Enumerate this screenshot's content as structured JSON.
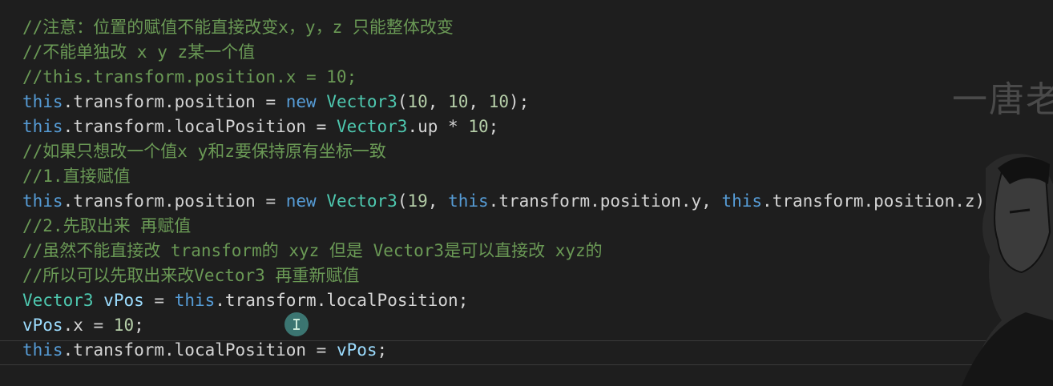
{
  "code": {
    "lines": [
      {
        "segments": [
          {
            "t": "//注意：位置的赋值不能直接改变x，y，z 只能整体改变",
            "c": "cmt"
          }
        ]
      },
      {
        "segments": [
          {
            "t": "//不能单独改 x y z某一个值",
            "c": "cmt"
          }
        ]
      },
      {
        "segments": [
          {
            "t": "//this.transform.position.x = 10;",
            "c": "cmt"
          }
        ]
      },
      {
        "segments": [
          {
            "t": "this",
            "c": "kw"
          },
          {
            "t": ".transform.position = ",
            "c": "plain"
          },
          {
            "t": "new",
            "c": "kw"
          },
          {
            "t": " ",
            "c": "plain"
          },
          {
            "t": "Vector3",
            "c": "typ"
          },
          {
            "t": "(",
            "c": "plain"
          },
          {
            "t": "10",
            "c": "num"
          },
          {
            "t": ", ",
            "c": "plain"
          },
          {
            "t": "10",
            "c": "num"
          },
          {
            "t": ", ",
            "c": "plain"
          },
          {
            "t": "10",
            "c": "num"
          },
          {
            "t": ");",
            "c": "plain"
          }
        ]
      },
      {
        "segments": [
          {
            "t": "this",
            "c": "kw"
          },
          {
            "t": ".transform.localPosition = ",
            "c": "plain"
          },
          {
            "t": "Vector3",
            "c": "typ"
          },
          {
            "t": ".up * ",
            "c": "plain"
          },
          {
            "t": "10",
            "c": "num"
          },
          {
            "t": ";",
            "c": "plain"
          }
        ]
      },
      {
        "segments": [
          {
            "t": "//如果只想改一个值x y和z要保持原有坐标一致",
            "c": "cmt"
          }
        ]
      },
      {
        "segments": [
          {
            "t": "//1.直接赋值",
            "c": "cmt"
          }
        ]
      },
      {
        "segments": [
          {
            "t": "this",
            "c": "kw"
          },
          {
            "t": ".transform.position = ",
            "c": "plain"
          },
          {
            "t": "new",
            "c": "kw"
          },
          {
            "t": " ",
            "c": "plain"
          },
          {
            "t": "Vector3",
            "c": "typ"
          },
          {
            "t": "(",
            "c": "plain"
          },
          {
            "t": "19",
            "c": "num"
          },
          {
            "t": ", ",
            "c": "plain"
          },
          {
            "t": "this",
            "c": "kw"
          },
          {
            "t": ".transform.position.y, ",
            "c": "plain"
          },
          {
            "t": "this",
            "c": "kw"
          },
          {
            "t": ".transform.position.z);",
            "c": "plain"
          }
        ]
      },
      {
        "segments": [
          {
            "t": "//2.先取出来 再赋值",
            "c": "cmt"
          }
        ]
      },
      {
        "segments": [
          {
            "t": "//虽然不能直接改 transform的 xyz 但是 Vector3是可以直接改 xyz的",
            "c": "cmt"
          }
        ]
      },
      {
        "segments": [
          {
            "t": "//所以可以先取出来改Vector3 再重新赋值",
            "c": "cmt"
          }
        ]
      },
      {
        "segments": [
          {
            "t": "Vector3",
            "c": "typ"
          },
          {
            "t": " ",
            "c": "plain"
          },
          {
            "t": "vPos",
            "c": "var"
          },
          {
            "t": " = ",
            "c": "plain"
          },
          {
            "t": "this",
            "c": "kw"
          },
          {
            "t": ".transform.localPosition;",
            "c": "plain"
          }
        ]
      },
      {
        "segments": [
          {
            "t": "vPos",
            "c": "var"
          },
          {
            "t": ".x = ",
            "c": "plain"
          },
          {
            "t": "10",
            "c": "num"
          },
          {
            "t": ";",
            "c": "plain"
          }
        ]
      },
      {
        "segments": [
          {
            "t": "this",
            "c": "kw"
          },
          {
            "t": ".transform.localPosition = ",
            "c": "plain"
          },
          {
            "t": "vPos",
            "c": "var"
          },
          {
            "t": ";",
            "c": "plain"
          }
        ]
      }
    ]
  },
  "watermark": {
    "text": "一唐老"
  },
  "cursor": {
    "icon": "text-cursor-icon"
  },
  "colors": {
    "background": "#1e1e1e",
    "comment": "#6a9955",
    "keyword": "#569cd6",
    "type": "#4ec9b0",
    "variable": "#9cdcfe",
    "number": "#b5cea8",
    "text": "#d4d4d4"
  }
}
